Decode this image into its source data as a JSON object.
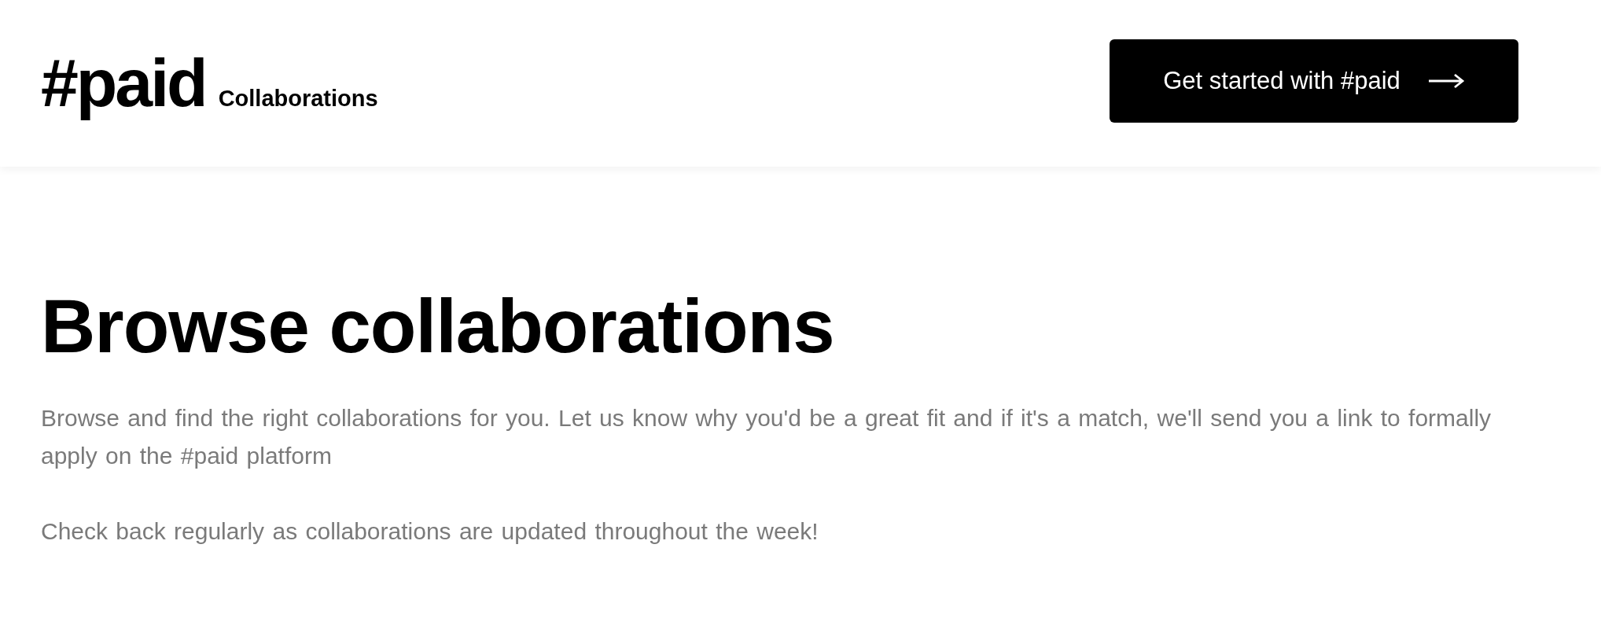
{
  "header": {
    "logo": "#paid",
    "logo_suffix": "Collaborations",
    "cta": "Get started with #paid"
  },
  "main": {
    "title": "Browse collaborations",
    "paragraphs": [
      "Browse and find the right collaborations for you. Let us know why you'd be a great fit and if it's a match, we'll send you a link to formally apply on the #paid platform",
      "Check back regularly as collaborations are updated throughout the week!"
    ]
  }
}
